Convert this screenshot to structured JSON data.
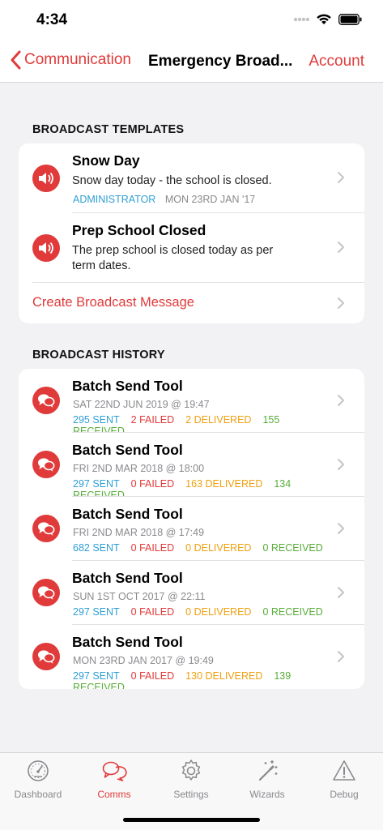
{
  "status": {
    "time": "4:34"
  },
  "nav": {
    "back_label": "Communication",
    "title": "Emergency Broad...",
    "right_label": "Account"
  },
  "templates": {
    "header": "BROADCAST TEMPLATES",
    "items": [
      {
        "title": "Snow Day",
        "body": "Snow day today - the school is closed.",
        "author": "ADMINISTRATOR",
        "date": "MON 23RD JAN '17"
      },
      {
        "title": "Prep School Closed",
        "body": "The prep school is closed today as per term dates."
      }
    ],
    "create_label": "Create Broadcast Message"
  },
  "history": {
    "header": "BROADCAST HISTORY",
    "items": [
      {
        "title": "Batch Send Tool",
        "date": "SAT 22ND JUN 2019 @ 19:47",
        "sent": "295 SENT",
        "failed": "2 FAILED",
        "delivered": "2 DELIVERED",
        "received": "155 RECEIVED"
      },
      {
        "title": "Batch Send Tool",
        "date": "FRI 2ND MAR 2018 @ 18:00",
        "sent": "297 SENT",
        "failed": "0 FAILED",
        "delivered": "163 DELIVERED",
        "received": "134 RECEIVED"
      },
      {
        "title": "Batch Send Tool",
        "date": "FRI 2ND MAR 2018 @ 17:49",
        "sent": "682 SENT",
        "failed": "0 FAILED",
        "delivered": "0 DELIVERED",
        "received": "0 RECEIVED"
      },
      {
        "title": "Batch Send Tool",
        "date": "SUN 1ST OCT 2017 @ 22:11",
        "sent": "297 SENT",
        "failed": "0 FAILED",
        "delivered": "0 DELIVERED",
        "received": "0 RECEIVED"
      },
      {
        "title": "Batch Send Tool",
        "date": "MON 23RD JAN 2017 @ 19:49",
        "sent": "297 SENT",
        "failed": "0 FAILED",
        "delivered": "130 DELIVERED",
        "received": "139 RECEIVED"
      }
    ]
  },
  "tabs": [
    {
      "label": "Dashboard",
      "icon": "gauge-icon"
    },
    {
      "label": "Comms",
      "icon": "chat-bubbles-icon",
      "active": true
    },
    {
      "label": "Settings",
      "icon": "gear-icon"
    },
    {
      "label": "Wizards",
      "icon": "magic-wand-icon"
    },
    {
      "label": "Debug",
      "icon": "warning-icon"
    }
  ],
  "colors": {
    "accent": "#e03a3a",
    "sent": "#2f9fd6",
    "delivered": "#f0a010",
    "received": "#57ad39",
    "muted": "#8a8a8e"
  }
}
